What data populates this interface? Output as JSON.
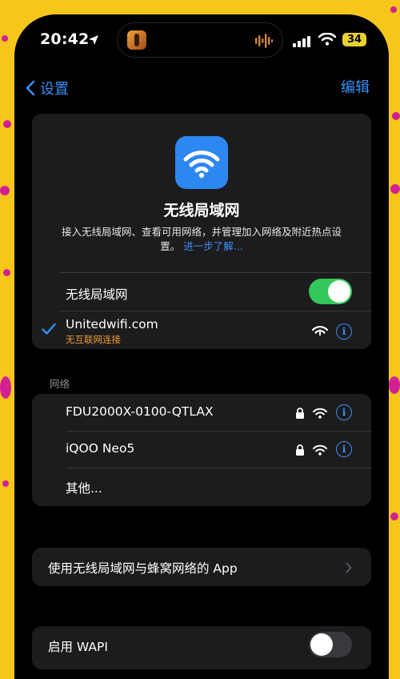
{
  "status_bar": {
    "time": "20:42",
    "battery": "34",
    "battery_color": "#ead12f"
  },
  "nav": {
    "back_label": "设置",
    "edit_label": "编辑"
  },
  "header": {
    "title": "无线局域网",
    "description": "接入无线局域网、查看可用网络，并管理加入网络及附近热点设置。",
    "learn_more": "进一步了解..."
  },
  "wlan_toggle": {
    "label": "无线局域网",
    "on": true,
    "on_color": "#34c759"
  },
  "connected": {
    "ssid": "Unitedwifi.com",
    "status": "无互联网连接",
    "status_color": "#f09a37"
  },
  "networks_section": {
    "title": "网络",
    "items": [
      {
        "name": "FDU2000X-0100-QTLAX",
        "locked": true
      },
      {
        "name": "iQOO Neo5",
        "locked": true
      }
    ],
    "other_label": "其他..."
  },
  "apps_row": {
    "label": "使用无线局域网与蜂窝网络的 App"
  },
  "wapi": {
    "label": "启用 WAPI",
    "on": false
  },
  "accent_color": "#3b8ff5"
}
